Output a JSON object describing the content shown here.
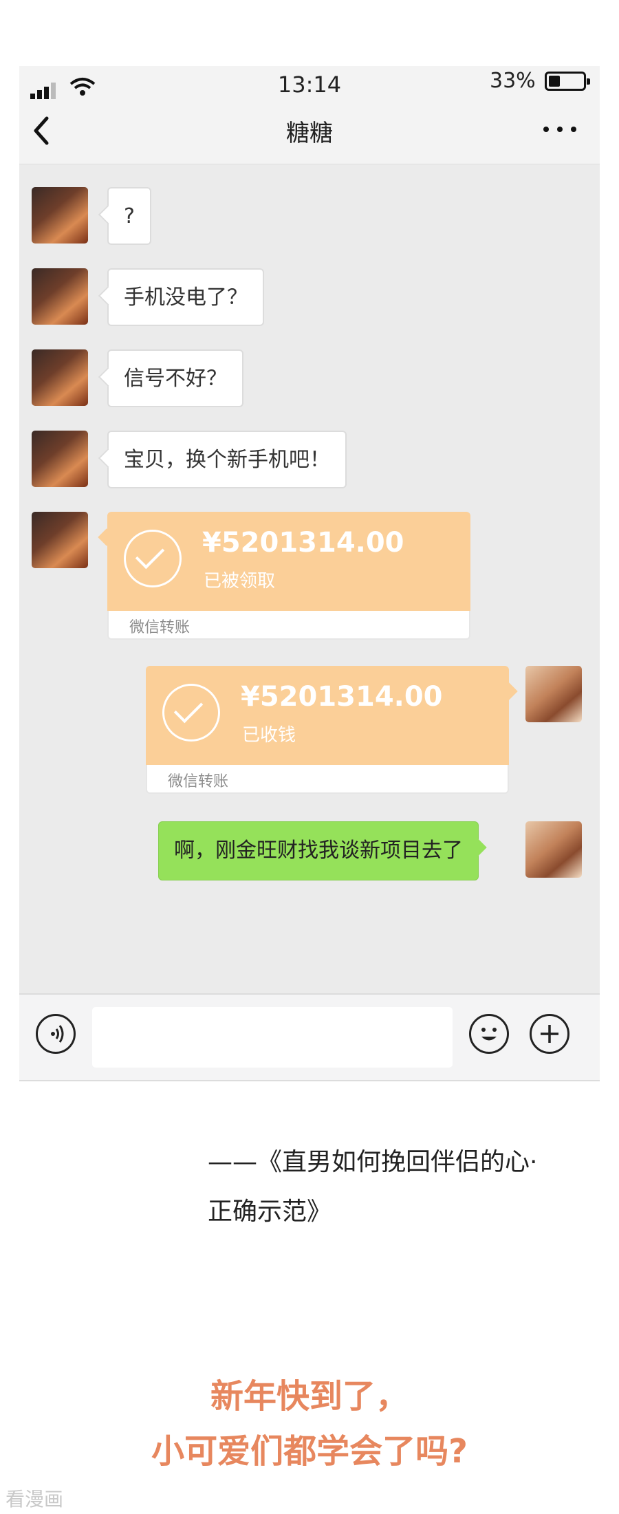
{
  "status_bar": {
    "time": "13:14",
    "battery_percent": "33%",
    "battery_level": 0.33
  },
  "header": {
    "title": "糖糖"
  },
  "messages": [
    {
      "side": "left",
      "type": "text",
      "text": "?"
    },
    {
      "side": "left",
      "type": "text",
      "text": "手机没电了？"
    },
    {
      "side": "left",
      "type": "text",
      "text": "信号不好？"
    },
    {
      "side": "left",
      "type": "text",
      "text": "宝贝，换个新手机吧！"
    },
    {
      "side": "left",
      "type": "transfer",
      "amount": "¥5201314.00",
      "status": "已被领取",
      "footer": "微信转账"
    },
    {
      "side": "right",
      "type": "transfer",
      "amount": "¥5201314.00",
      "status": "已收钱",
      "footer": "微信转账"
    },
    {
      "side": "right",
      "type": "text",
      "text": "啊，刚金旺财找我谈新项目去了"
    }
  ],
  "input_bar": {
    "voice_icon": "voice-icon",
    "emoji_icon": "emoji-icon",
    "plus_icon": "plus-icon"
  },
  "caption": {
    "line1": "——《直男如何挽回伴侣的心·",
    "line2": "正确示范》"
  },
  "promo": {
    "line1": "新年快到了，",
    "line2": "小可爱们都学会了吗?"
  },
  "watermark": "看漫画",
  "colors": {
    "transfer": "#fbcf98",
    "outgoing_bubble": "#95e15a",
    "promo_text": "#e7875e"
  }
}
